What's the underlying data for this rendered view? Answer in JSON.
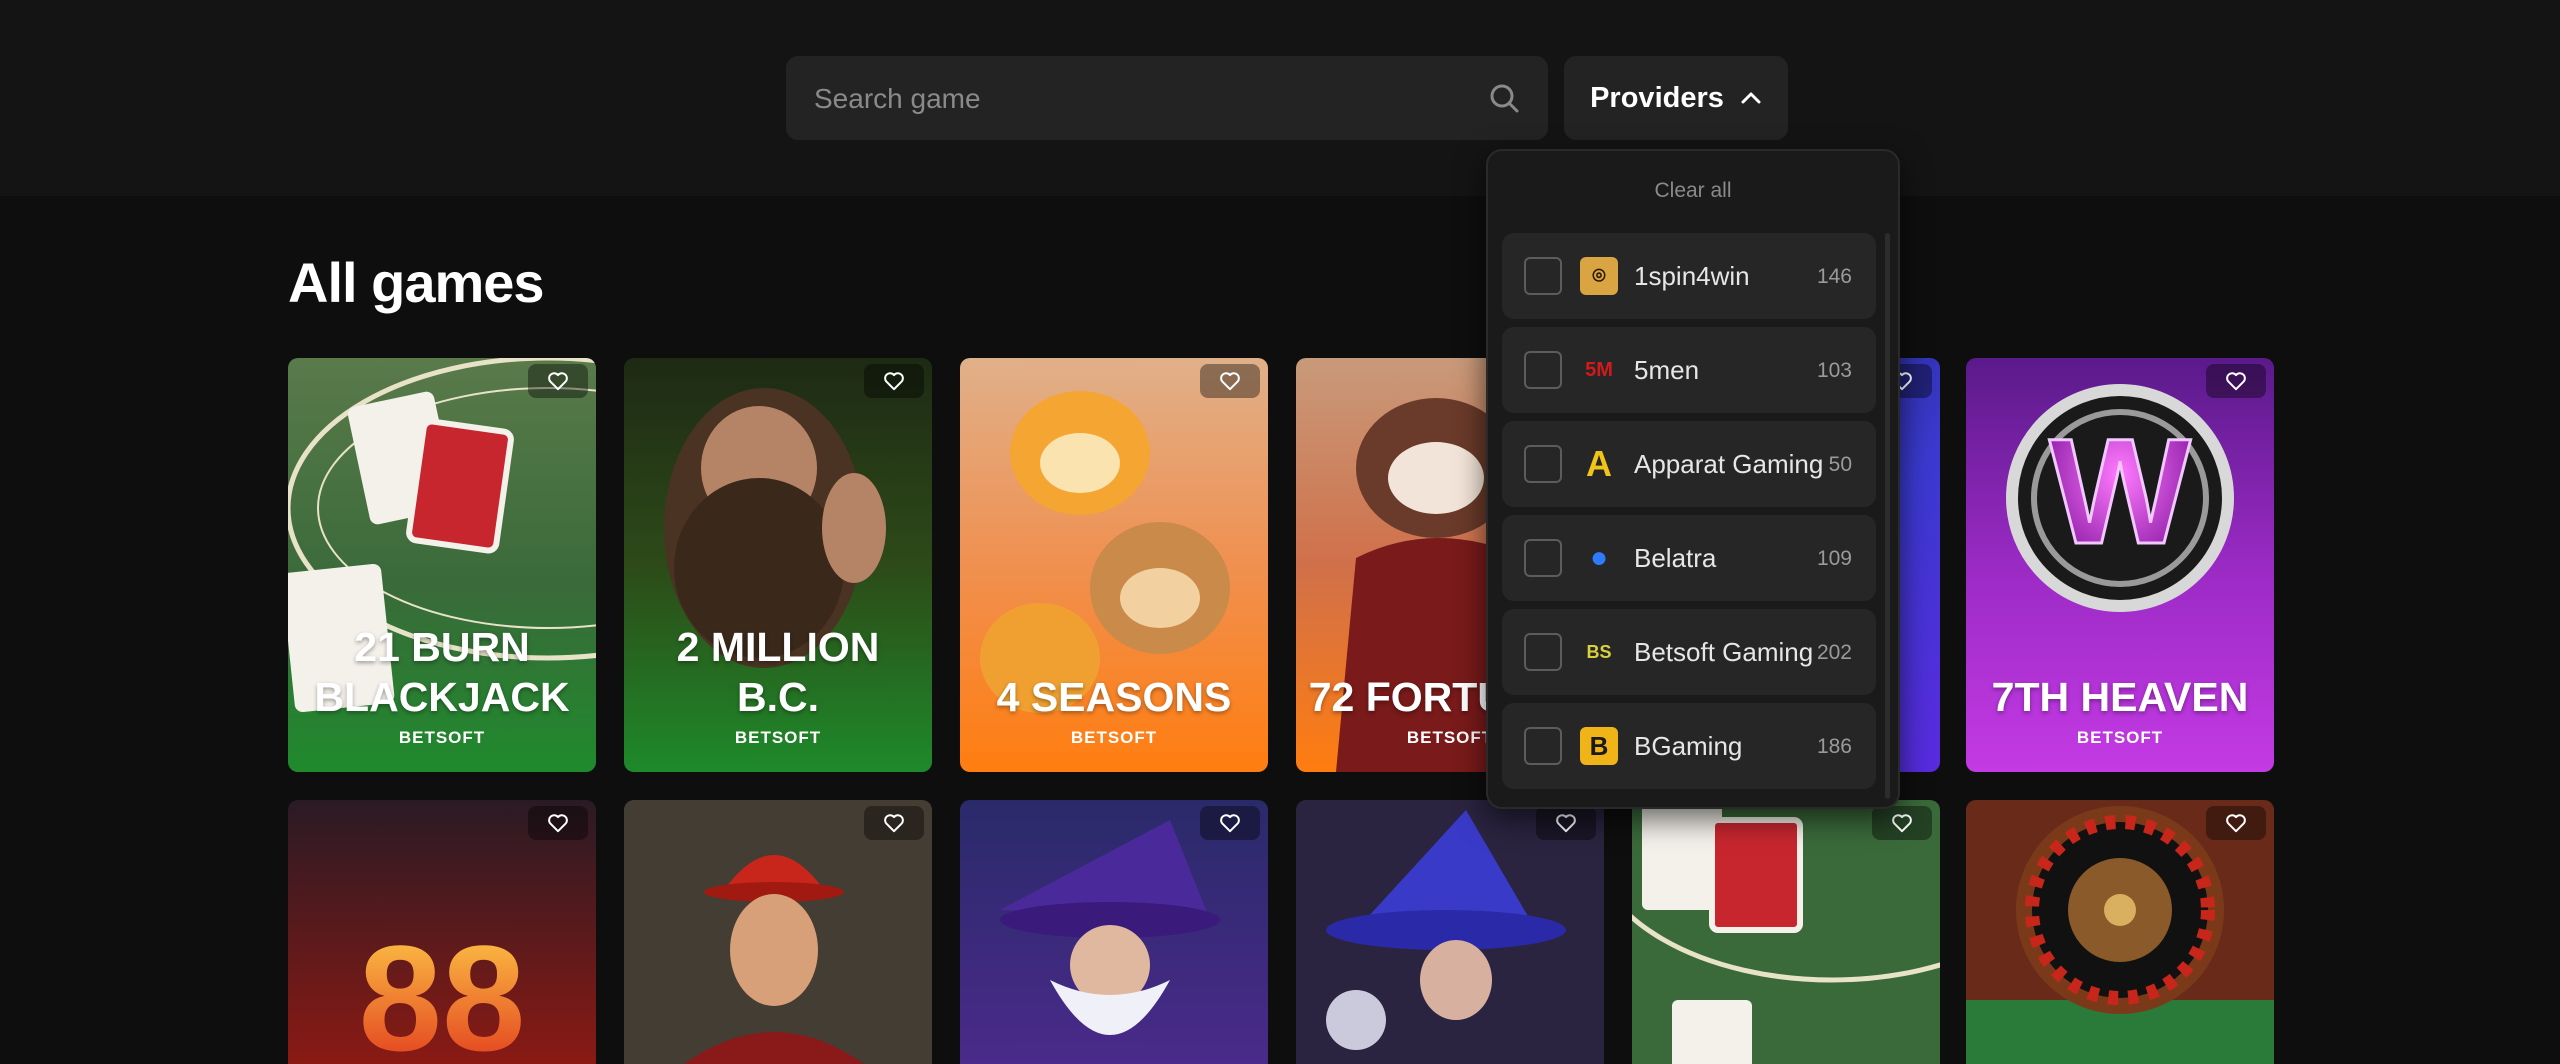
{
  "header": {
    "search": {
      "placeholder": "Search game",
      "icon": "search-icon"
    },
    "providers_button": {
      "label": "Providers",
      "icon": "chevron-up-icon"
    }
  },
  "main": {
    "title": "All games",
    "games": [
      {
        "name": "21 BURN\nBLACKJACK",
        "provider": "BETSOFT",
        "color": "#2a9a3a"
      },
      {
        "name": "2 MILLION B.C.",
        "provider": "BETSOFT",
        "color": "#1f8f2c"
      },
      {
        "name": "4 SEASONS",
        "provider": "BETSOFT",
        "color": "#ff8a1a"
      },
      {
        "name": "72 FORTUNES",
        "provider": "BETSOFT",
        "color": "#ff8a1a"
      },
      {
        "name": "",
        "provider": "",
        "color": "#3a3ad0"
      },
      {
        "name": "7TH HEAVEN",
        "provider": "BETSOFT",
        "color": "#b43ad4"
      },
      {
        "name": "",
        "provider": "",
        "color": "#7a1616"
      },
      {
        "name": "",
        "provider": "",
        "color": "#3a2a24"
      },
      {
        "name": "",
        "provider": "",
        "color": "#3a2a8a"
      },
      {
        "name": "",
        "provider": "",
        "color": "#4a3a6a"
      },
      {
        "name": "",
        "provider": "",
        "color": "#2a6a3a"
      },
      {
        "name": "",
        "provider": "",
        "color": "#7a2a1a"
      }
    ]
  },
  "providers_dropdown": {
    "clear_all": "Clear all",
    "items": [
      {
        "name": "1spin4win",
        "count": "146",
        "logo_icon": "1spin4win-logo-icon",
        "logo_text": "⌾",
        "logo_bg": "#d9a441",
        "logo_fg": "#2a1a00"
      },
      {
        "name": "5men",
        "count": "103",
        "logo_icon": "5men-logo-icon",
        "logo_text": "5M",
        "logo_bg": "#ffffff",
        "logo_fg": "#d11a1a"
      },
      {
        "name": "Apparat Gaming",
        "count": "50",
        "logo_icon": "apparat-logo-icon",
        "logo_text": "A",
        "logo_bg": "transparent",
        "logo_fg": "#f0c419"
      },
      {
        "name": "Belatra",
        "count": "109",
        "logo_icon": "belatra-logo-icon",
        "logo_text": "●",
        "logo_bg": "transparent",
        "logo_fg": "#2f7bff"
      },
      {
        "name": "Betsoft Gaming",
        "count": "202",
        "logo_icon": "betsoft-logo-icon",
        "logo_text": "BS",
        "logo_bg": "transparent",
        "logo_fg": "#d9d040"
      },
      {
        "name": "BGaming",
        "count": "186",
        "logo_icon": "bgaming-logo-icon",
        "logo_text": "B",
        "logo_bg": "#f0b419",
        "logo_fg": "#1a1a1a"
      }
    ]
  }
}
